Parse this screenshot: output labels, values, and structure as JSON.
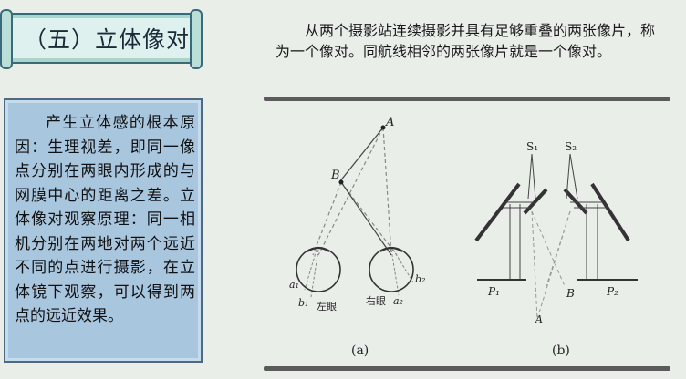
{
  "banner": {
    "title": "（五）立体像对"
  },
  "intro": {
    "text": "从两个摄影站连续摄影并具有足够重叠的两张像片，称为一个像对。同航线相邻的两张像片就是一个像对。"
  },
  "side_panel": {
    "text": "产生立体感的根本原因：生理视差，即同一像点分别在两眼内形成的与网膜中心的距离之差。立体像对观察原理：同一相机分别在两地对两个远近不同的点进行摄影，在立体镜下观察，可以得到两点的远近效果。"
  },
  "figure_a": {
    "point_A": "A",
    "point_B": "B",
    "a1": "a₁",
    "b1": "b₁",
    "left_eye": "左眼",
    "right_eye": "右眼",
    "a2": "a₂",
    "b2": "b₂",
    "caption": "(a)"
  },
  "figure_b": {
    "S1": "S₁",
    "S2": "S₂",
    "P1": "P₁",
    "P2": "P₂",
    "B": "B",
    "A": "A",
    "caption": "(b)"
  },
  "colors": {
    "background": "#e9eee9",
    "panel": "#a9c6df",
    "banner": "#dff1ee",
    "rule": "#5b5b5b"
  }
}
